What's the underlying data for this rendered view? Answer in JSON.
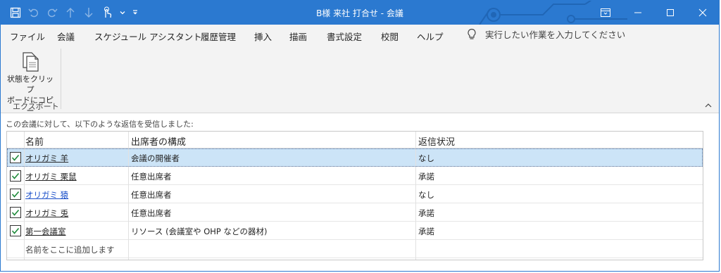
{
  "window": {
    "title": "B様 来社 打合せ - 会議",
    "accent_color": "#2b79d0"
  },
  "quick_access": [
    {
      "icon": "save-icon"
    },
    {
      "icon": "undo-icon"
    },
    {
      "icon": "redo-icon"
    },
    {
      "icon": "up-arrow-icon"
    },
    {
      "icon": "down-arrow-icon"
    },
    {
      "icon": "touch-mode-icon"
    },
    {
      "icon": "chevron-down-icon"
    },
    {
      "icon": "customize-qat-icon"
    }
  ],
  "tabs": [
    {
      "label": "ファイル",
      "active": false
    },
    {
      "label": "会議",
      "active": false
    },
    {
      "label": "スケジュール アシスタント",
      "active": false
    },
    {
      "label": "履歴管理",
      "active": true
    },
    {
      "label": "挿入",
      "active": false
    },
    {
      "label": "描画",
      "active": false
    },
    {
      "label": "書式設定",
      "active": false
    },
    {
      "label": "校閲",
      "active": false
    },
    {
      "label": "ヘルプ",
      "active": false
    }
  ],
  "tellme": {
    "label": "実行したい作業を入力してください",
    "icon": "lightbulb-icon"
  },
  "ribbon": {
    "copy_status_line1": "状態をクリップ",
    "copy_status_line2": "ボードにコピー",
    "group_label": "エクスポート"
  },
  "info_text": "この会議に対して、以下のような返信を受信しました:",
  "table": {
    "columns": [
      "名前",
      "出席者の構成",
      "返信状況"
    ],
    "rows": [
      {
        "checked": true,
        "name": "オリガミ 羊",
        "role": "会議の開催者",
        "response": "なし",
        "selected": true,
        "link": false
      },
      {
        "checked": true,
        "name": "オリガミ 栗鼠",
        "role": "任意出席者",
        "response": "承諾",
        "selected": false,
        "link": false
      },
      {
        "checked": true,
        "name": "オリガミ 猿",
        "role": "任意出席者",
        "response": "なし",
        "selected": false,
        "link": true
      },
      {
        "checked": true,
        "name": "オリガミ 兎",
        "role": "任意出席者",
        "response": "承諾",
        "selected": false,
        "link": false
      },
      {
        "checked": true,
        "name": "第一会議室",
        "role": "リソース (会議室や OHP などの器材)",
        "response": "承諾",
        "selected": false,
        "link": false
      }
    ],
    "add_placeholder": "名前をここに追加します"
  }
}
